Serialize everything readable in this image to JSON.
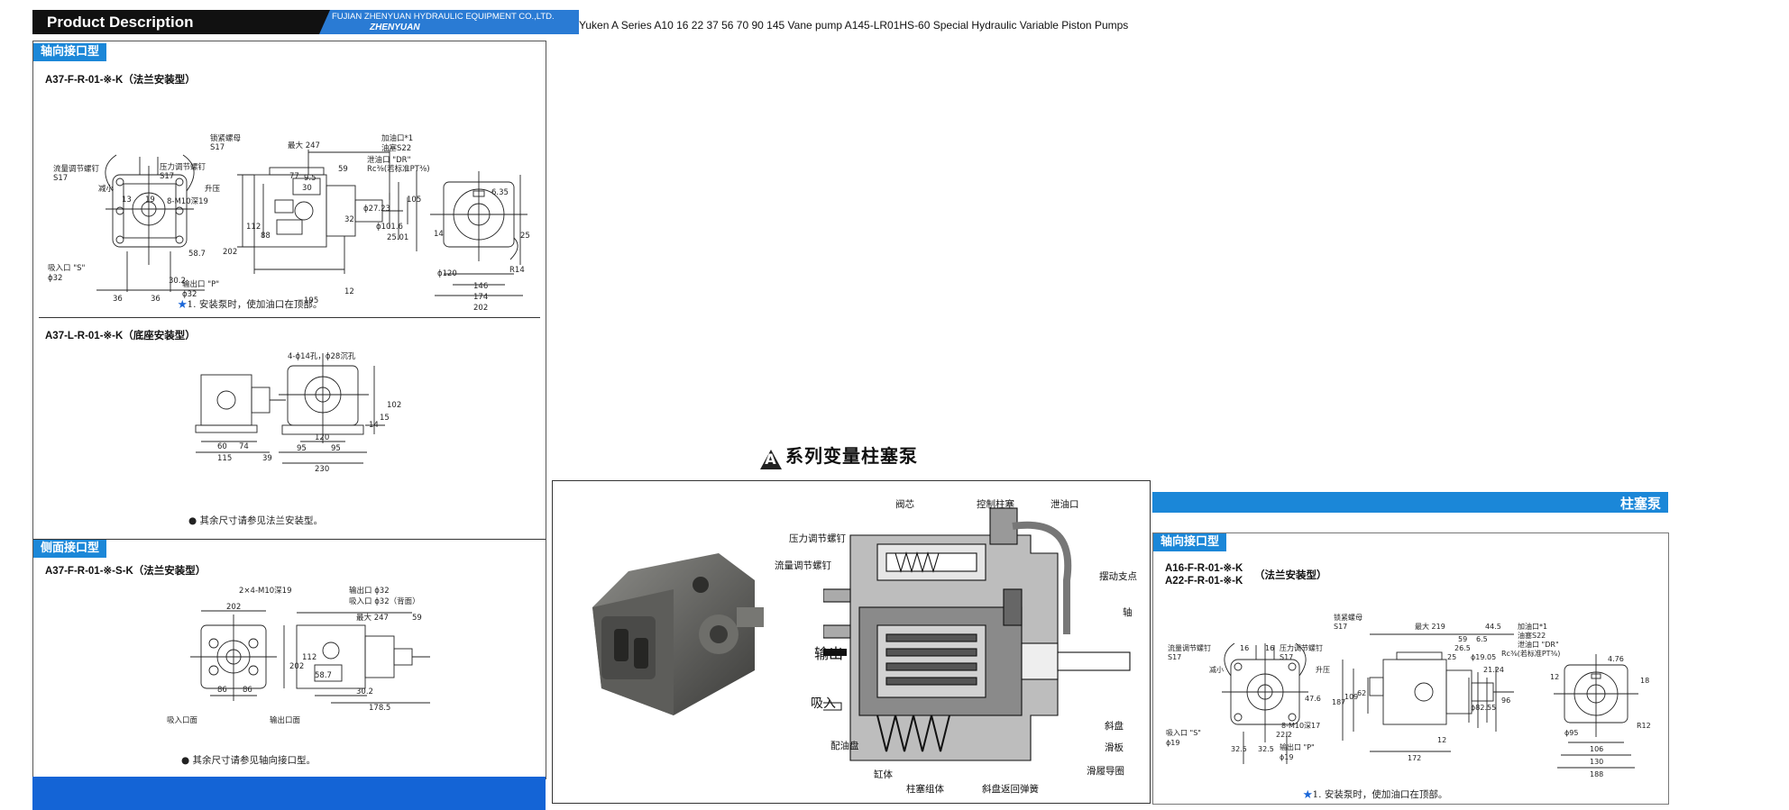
{
  "header": {
    "title": "Product Description",
    "company": "FUJIAN ZHENYUAN HYDRAULIC EQUIPMENT CO.,LTD.",
    "logo": "ZHENYUAN"
  },
  "page_caption": "Yuken A Series A10 16 22 37 56 70 90 145 Vane pump A145-LR01HS-60 Special Hydraulic Variable Piston Pumps",
  "left": {
    "section1_tag": "轴向接口型",
    "model1": "A37-F-R-01-※-K（法兰安装型）",
    "note1": "安装泵时，使加油口在顶部。",
    "model2": "A37-L-R-01-※-K（底座安装型）",
    "note2": "其余尺寸请参见法兰安装型。",
    "section2_tag": "侧面接口型",
    "model3": "A37-F-R-01-※-S-K（法兰安装型）",
    "note3": "其余尺寸请参见轴向接口型。",
    "dim1": {
      "lock_nut": "锁紧螺母",
      "s17a": "S17",
      "max247": "最大 247",
      "fill_port": "加油口*1",
      "hex_s22": "油塞S22",
      "drain": "泄油口 \"DR\"",
      "rc": "Rc⅜(若标准PT⅜)",
      "flow_screw": "流量调节螺钉",
      "s17b": "S17",
      "press_screw": "压力调节螺钉",
      "s17c": "S17",
      "decrease": "减小",
      "increase": "升压",
      "bolts": "8-M10深19",
      "suction": "吸入口 \"S\"",
      "phi32a": "ϕ32",
      "outlet": "输出口 \"P\"",
      "phi32b": "ϕ32",
      "d13": "13",
      "d19": "19",
      "d59": "59",
      "d77": "77",
      "d95": "9.5",
      "d30": "30",
      "d32": "32",
      "d202": "202",
      "d112": "112",
      "d88": "88",
      "d587": "58.7",
      "d302": "30.2",
      "d36a": "36",
      "d36b": "36",
      "d195": "195",
      "d12": "12",
      "d146": "146",
      "d174": "174",
      "d202b": "202",
      "d635": "6.35",
      "d14": "14",
      "d25": "25",
      "d105": "105",
      "phi120": "ϕ120",
      "r14": "R14",
      "phi27": "ϕ27.23",
      "phi101": "ϕ101.6",
      "d2501": "25.01"
    },
    "dim2": {
      "holes": "4-ϕ14孔，ϕ28沉孔",
      "d60": "60",
      "d74": "74",
      "d115": "115",
      "d39": "39",
      "d120": "120",
      "d95a": "95",
      "d95b": "95",
      "d230": "230",
      "d14": "14",
      "d15": "15",
      "d102": "102"
    },
    "dim3": {
      "bolts": "2×4-M10深19",
      "outlet": "输出口 ϕ32",
      "suction": "吸入口 ϕ32（背面）",
      "max247": "最大 247",
      "d59": "59",
      "d202": "202",
      "d112": "112",
      "d202b": "202",
      "d86a": "86",
      "d86b": "86",
      "d302": "30.2",
      "d1785": "178.5",
      "d587": "58.7",
      "suction_side": "吸入口面",
      "outlet_side": "输出口面"
    }
  },
  "middle": {
    "title": "系列变量柱塞泵",
    "badge": "A",
    "labels": {
      "valve": "阀芯",
      "ctrl_piston": "控制柱塞",
      "drain": "泄油口",
      "press_screw": "压力调节螺钉",
      "flow_screw": "流量调节螺钉",
      "pivot": "摆动支点",
      "outlet": "输出",
      "suction": "吸入",
      "shaft": "轴",
      "valve_plate": "配油盘",
      "cylinder": "缸体",
      "swash": "斜盘",
      "shoe": "滑板",
      "piston": "柱塞组体",
      "shoe_ring": "滑履导圈",
      "return_spring": "斜盘返回弹簧"
    }
  },
  "right": {
    "band_label": "柱塞泵",
    "section_tag": "轴向接口型",
    "model_a": "A16-F-R-01-※-K",
    "model_b": "A22-F-R-01-※-K",
    "model_suffix": "（法兰安装型）",
    "note": "安装泵时，使加油口在顶部。",
    "dim": {
      "lock_nut": "锁紧螺母",
      "s17a": "S17",
      "max219": "最大 219",
      "d445": "44.5",
      "fill_port": "加油口*1",
      "hex_s22": "油塞S22",
      "drain": "泄油口 \"DR\"",
      "rc": "Rc⅜(若标准PT⅜)",
      "d59": "59",
      "d65": "6.5",
      "d265": "26.5",
      "d25": "25",
      "flow_screw": "流量调节螺钉",
      "s17b": "S17",
      "press_screw": "压力调节螺钉",
      "s17c": "S17",
      "decrease": "减小",
      "increase": "升压",
      "d16a": "16",
      "d16b": "16",
      "d187": "187",
      "d109": "109",
      "d62": "62",
      "d476": "47.6",
      "d222": "22.2",
      "bolts": "8-M10深17",
      "suction": "吸入口 \"S\"",
      "phi19a": "ϕ19",
      "outlet": "输出口 \"P\"",
      "phi19b": "ϕ19",
      "d325a": "32.5",
      "d325b": "32.5",
      "d12": "12",
      "d172": "172",
      "phi1905": "ϕ19.05",
      "d2124": "21.24",
      "phi8255": "ϕ82.55",
      "d96": "96",
      "d12b": "12",
      "d476b": "4.76",
      "d18": "18",
      "phi95": "ϕ95",
      "d106": "106",
      "d130": "130",
      "d188": "188",
      "r12": "R12"
    }
  }
}
